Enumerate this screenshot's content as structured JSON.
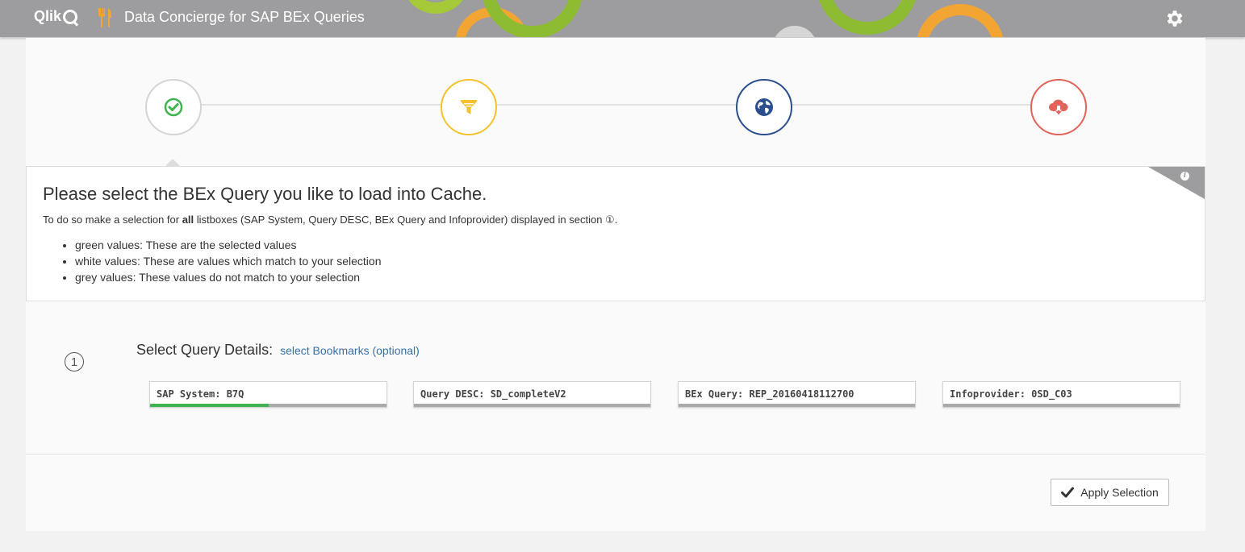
{
  "header": {
    "logo_text": "Qlik",
    "app_title": "Data Concierge for SAP BEx Queries"
  },
  "colors": {
    "header_bg": "#9d9d9f",
    "step_done": "#3fb34f",
    "step_filter": "#f5c12d",
    "step_globe": "#2b4f8e",
    "step_download": "#e2635a",
    "link": "#3a6fa8",
    "selection_green": "#3fb34f"
  },
  "stepper": {
    "steps": [
      {
        "name": "check-circle-icon",
        "state": "done"
      },
      {
        "name": "filter-icon",
        "state": "pending"
      },
      {
        "name": "globe-icon",
        "state": "pending"
      },
      {
        "name": "cloud-download-icon",
        "state": "pending"
      }
    ]
  },
  "info": {
    "title": "Please select the BEx Query you like to load into Cache.",
    "text_before": "To do so make a selection for ",
    "text_bold": "all",
    "text_after": " listboxes (SAP System, Query DESC, BEx Query and Infoprovider) displayed in section ",
    "section_ref": "①",
    "text_end": ".",
    "legend": [
      "green values: These are the selected values",
      "white values: These are values which match to your selection",
      "grey values: These values do not match to your selection"
    ]
  },
  "query_details": {
    "section_number": "1",
    "title": "Select Query Details:",
    "bookmark_link": "select Bookmarks (optional)",
    "listboxes": [
      {
        "label": "SAP System: B7Q",
        "selected_fraction": 0.5
      },
      {
        "label": "Query DESC: SD_completeV2",
        "selected_fraction": 0.0
      },
      {
        "label": "BEx Query: REP_20160418112700",
        "selected_fraction": 0.0
      },
      {
        "label": "Infoprovider: 0SD_C03",
        "selected_fraction": 0.0
      }
    ]
  },
  "footer": {
    "apply_label": "Apply Selection"
  }
}
